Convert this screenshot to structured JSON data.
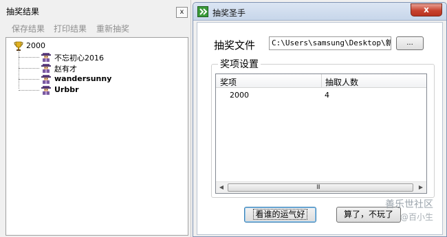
{
  "left_panel": {
    "title": "抽奖结果",
    "close_glyph": "x",
    "toolbar": [
      "保存结果",
      "打印结果",
      "重新抽奖"
    ],
    "tree": {
      "root": "2000",
      "items": [
        "不忘初心2016",
        "赵有才",
        "wandersunny",
        "Urbbr"
      ]
    }
  },
  "window": {
    "title": "抽奖圣手",
    "close_glyph": "x",
    "file_label": "抽奖文件",
    "file_path": "C:\\Users\\samsung\\Desktop\\新建",
    "browse_label": "...",
    "group_label": "奖项设置",
    "columns": [
      "奖项",
      "抽取人数"
    ],
    "rows": [
      [
        "2000",
        "4"
      ]
    ],
    "scroll_grip": "III",
    "lucky_button": "看谁的运气好",
    "quit_button": "算了，不玩了"
  },
  "watermark": {
    "line1": "善乐世社区",
    "line2": "@百小生"
  }
}
